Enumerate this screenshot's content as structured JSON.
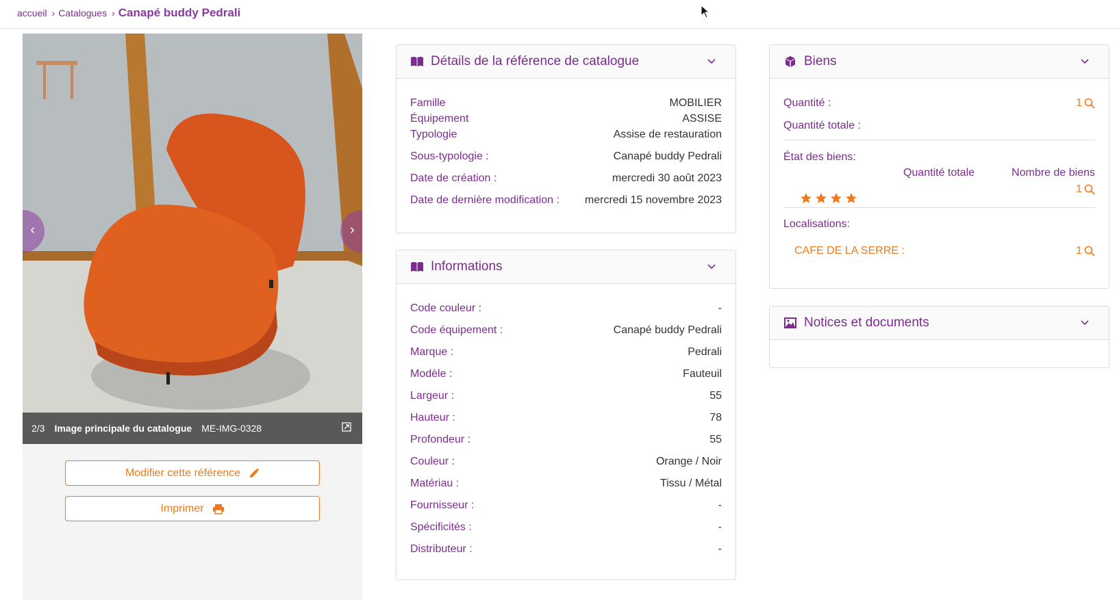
{
  "breadcrumb": {
    "home": "accueil",
    "catalogues": "Catalogues",
    "current": "Canapé buddy Pedrali"
  },
  "gallery": {
    "index": "2/3",
    "title": "Image principale du catalogue",
    "code": "ME-IMG-0328",
    "prev_label": "‹",
    "next_label": "›"
  },
  "actions": {
    "edit_label": "Modifier cette référence",
    "print_label": "Imprimer"
  },
  "details": {
    "title": "Détails de la référence de catalogue",
    "rows": [
      {
        "label": "Famille",
        "value": "MOBILIER"
      },
      {
        "label": "Équipement",
        "value": "ASSISE"
      },
      {
        "label": "Typologie",
        "value": "Assise de restauration"
      },
      {
        "label": "Sous-typologie :",
        "value": "Canapé buddy Pedrali"
      },
      {
        "label": "Date de création :",
        "value": "mercredi 30 août 2023"
      },
      {
        "label": "Date de dernière modification :",
        "value": "mercredi 15 novembre 2023"
      }
    ]
  },
  "informations": {
    "title": "Informations",
    "rows": [
      {
        "label": "Code couleur :",
        "value": "-"
      },
      {
        "label": "Code équipement :",
        "value": "Canapé buddy Pedrali"
      },
      {
        "label": "Marque :",
        "value": "Pedrali"
      },
      {
        "label": "Modèle :",
        "value": "Fauteuil"
      },
      {
        "label": "Largeur :",
        "value": "55"
      },
      {
        "label": "Hauteur :",
        "value": "78"
      },
      {
        "label": "Profondeur :",
        "value": "55"
      },
      {
        "label": "Couleur :",
        "value": "Orange / Noir"
      },
      {
        "label": "Matériau :",
        "value": "Tissu / Métal"
      },
      {
        "label": "Fournisseur :",
        "value": "-"
      },
      {
        "label": "Spécificités :",
        "value": "-"
      },
      {
        "label": "Distributeur :",
        "value": "-"
      }
    ]
  },
  "biens": {
    "title": "Biens",
    "quantite_label": "Quantité :",
    "quantite_value": "1",
    "quantite_totale_label": "Quantité totale :",
    "etat_label": "État des biens:",
    "col_quantite_totale": "Quantité totale",
    "col_nombre_biens": "Nombre de biens",
    "etat_rating": 4,
    "etat_value": "1",
    "localisations_label": "Localisations:",
    "localisation_name": "CAFE DE LA SERRE :",
    "localisation_value": "1"
  },
  "notices": {
    "title": "Notices et documents"
  },
  "colors": {
    "brand_purple": "#7b2d8e",
    "accent_orange": "#f07a1a"
  }
}
